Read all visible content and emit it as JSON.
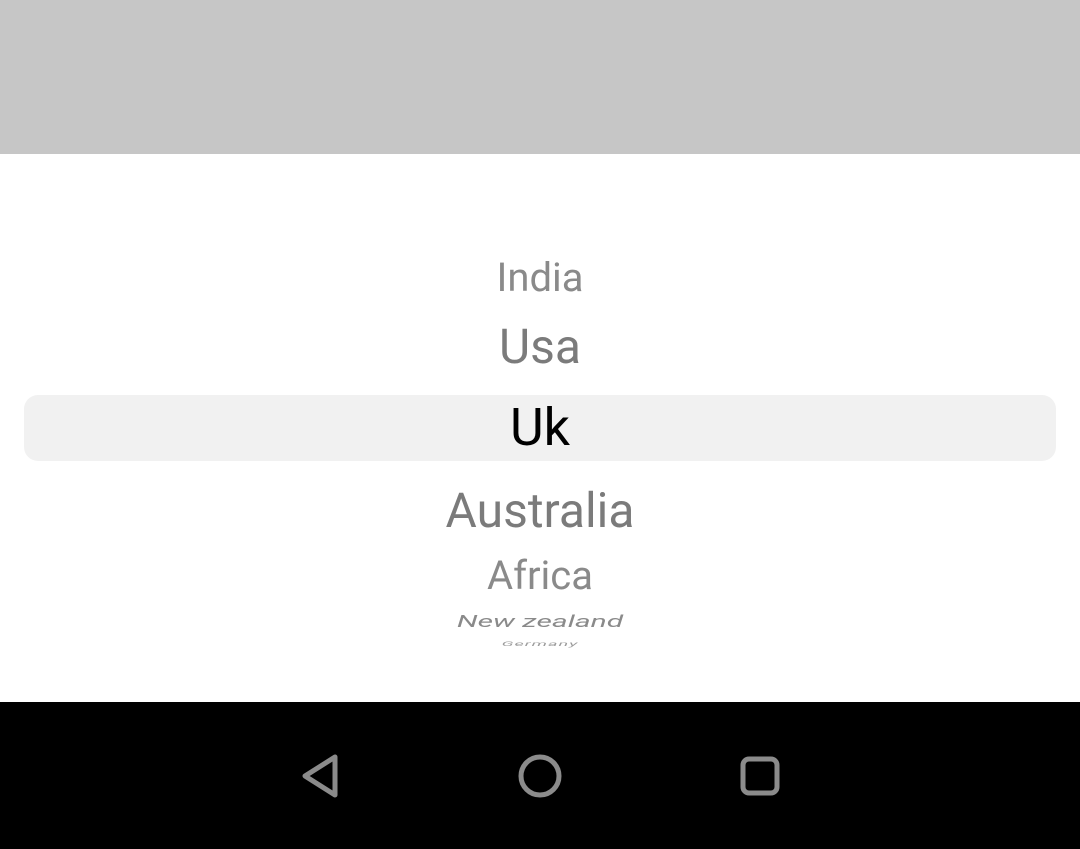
{
  "picker": {
    "items": [
      {
        "label": "India"
      },
      {
        "label": "Usa"
      },
      {
        "label": "Uk"
      },
      {
        "label": "Australia"
      },
      {
        "label": "Africa"
      },
      {
        "label": "New zealand"
      },
      {
        "label": "Germany"
      }
    ],
    "selected_index": 2
  }
}
